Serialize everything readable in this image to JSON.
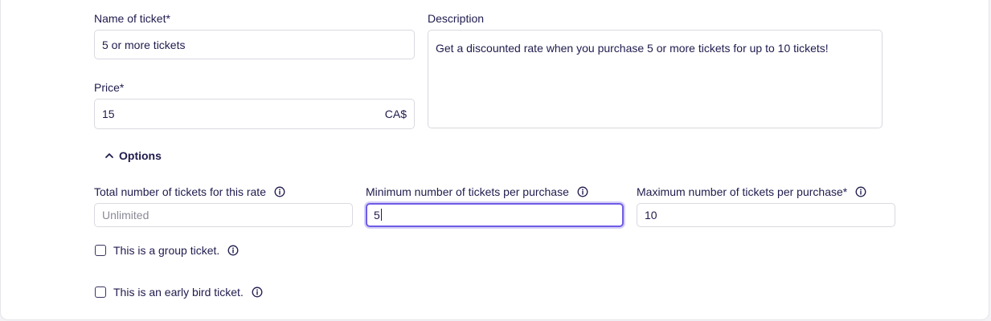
{
  "ticket": {
    "name_label": "Name of ticket*",
    "name_value": "5 or more tickets",
    "price_label": "Price*",
    "price_value": "15",
    "currency": "CA$",
    "description_label": "Description",
    "description_value": "Get a discounted rate when you purchase 5 or more tickets for up to 10 tickets!"
  },
  "options": {
    "toggle_label": "Options",
    "toggle_icon": "chevron-up-icon",
    "total_label": "Total number of tickets for this rate",
    "total_placeholder": "Unlimited",
    "min_label": "Minimum number of tickets per purchase",
    "min_value": "5",
    "max_label": "Maximum number of tickets per purchase*",
    "max_value": "10",
    "group_label": "This is a group ticket.",
    "group_checked": false,
    "early_bird_label": "This is an early bird ticket.",
    "early_bird_checked": false
  },
  "colors": {
    "text": "#1f1b4d",
    "focus_border": "#6e5ce6",
    "field_border": "#d9d9e0",
    "placeholder": "#8a8a98"
  }
}
